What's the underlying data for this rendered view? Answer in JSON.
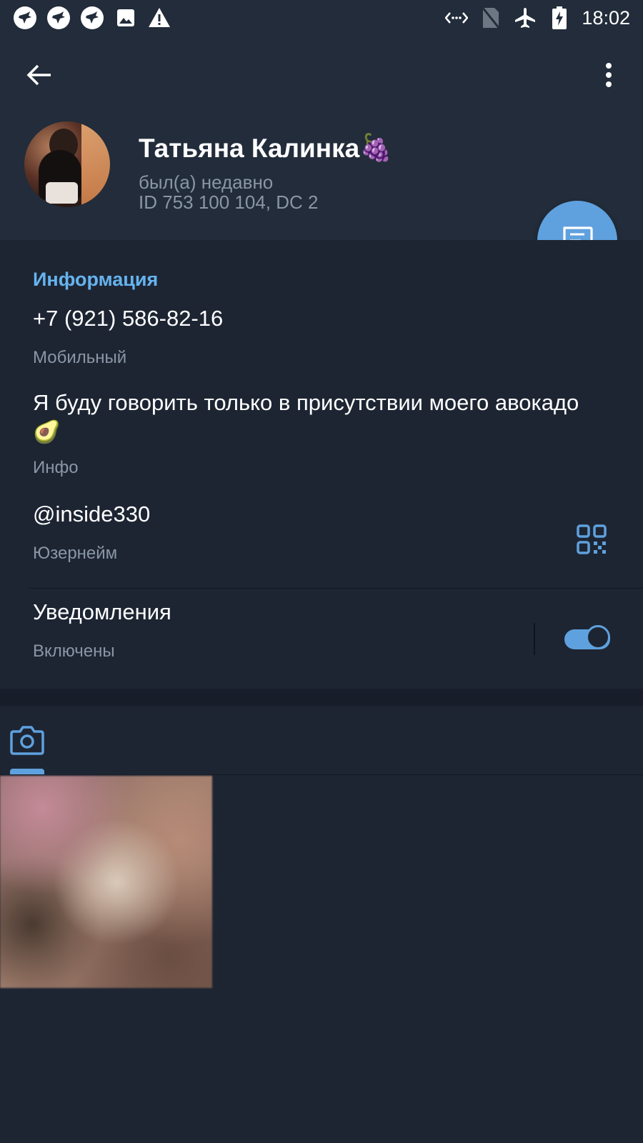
{
  "status_bar": {
    "left_icons": [
      "bird-notification-icon",
      "bird-notification-icon",
      "bird-notification-icon",
      "image-notification-icon",
      "warning-icon"
    ],
    "right_icons": [
      "data-saver-icon",
      "no-sim-icon",
      "airplane-mode-icon",
      "battery-charging-icon"
    ],
    "time": "18:02"
  },
  "toolbar": {
    "back_icon": "arrow-left-icon",
    "more_icon": "more-vertical-icon"
  },
  "profile": {
    "name": "Татьяна Калинка",
    "name_emoji": "🍇",
    "status": "был(а) недавно",
    "id_line": "ID 753 100 104, DC 2"
  },
  "fab": {
    "icon": "message-icon"
  },
  "info": {
    "section_title": "Информация",
    "phone": "+7 (921) 586-82-16",
    "phone_label": "Мобильный",
    "bio": "Я буду говорить только в присутствии моего авокадо",
    "bio_emoji": "🥑",
    "bio_label": "Инфо",
    "username": "@inside330",
    "username_label": "Юзернейм",
    "notifications": "Уведомления",
    "notifications_status": "Включены",
    "notifications_enabled": true
  },
  "media": {
    "active_tab_icon": "camera-icon"
  },
  "colors": {
    "accent": "#5fa1de",
    "section_title": "#66b3ee",
    "background": "#1d2533",
    "header": "#222c3a"
  }
}
